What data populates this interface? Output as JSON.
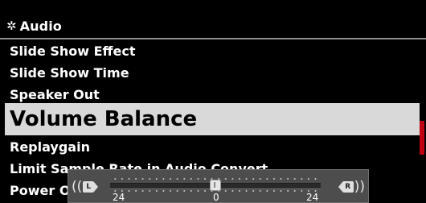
{
  "header": {
    "title": "Audio",
    "icon": "gear-icon"
  },
  "menu": {
    "items": [
      {
        "label": "Slide Show Effect"
      },
      {
        "label": "Slide Show Time"
      },
      {
        "label": "Speaker Out"
      },
      {
        "label": "Volume Balance",
        "selected": true
      },
      {
        "label": "Replaygain"
      },
      {
        "label": "Limit Sample Rate in Audio Convert"
      },
      {
        "label": "Power O"
      }
    ]
  },
  "balance": {
    "left_label": "L",
    "right_label": "R",
    "min_label": "24",
    "center_label": "0",
    "max_label": "24",
    "value": 0,
    "range": [
      -24,
      24
    ]
  },
  "colors": {
    "background": "#000000",
    "selected_bg": "#d9d9d9",
    "scrollbar": "#c00010",
    "overlay_bg": "#4d4d4d"
  }
}
